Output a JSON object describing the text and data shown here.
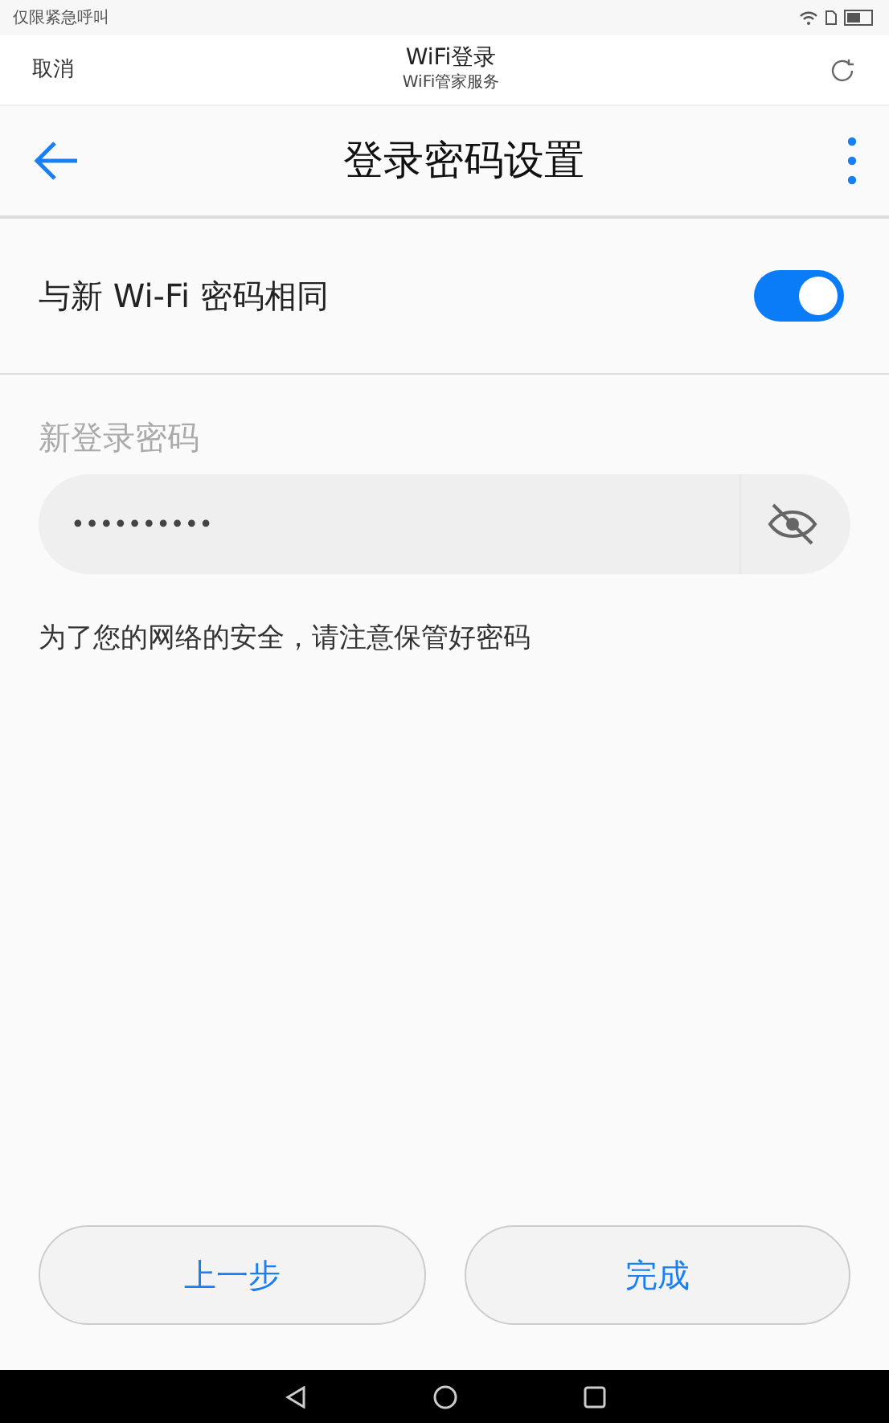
{
  "status_bar": {
    "carrier": "仅限紧急呼叫"
  },
  "header": {
    "cancel": "取消",
    "title": "WiFi登录",
    "subtitle": "WiFi管家服务"
  },
  "app_bar": {
    "title": "登录密码设置"
  },
  "same_password": {
    "label": "与新 Wi-Fi 密码相同",
    "on": true
  },
  "password": {
    "label": "新登录密码",
    "value": "••••••••••",
    "visible": false
  },
  "hint": "为了您的网络的安全，请注意保管好密码",
  "buttons": [
    {
      "label": "上一步"
    },
    {
      "label": "完成"
    }
  ]
}
